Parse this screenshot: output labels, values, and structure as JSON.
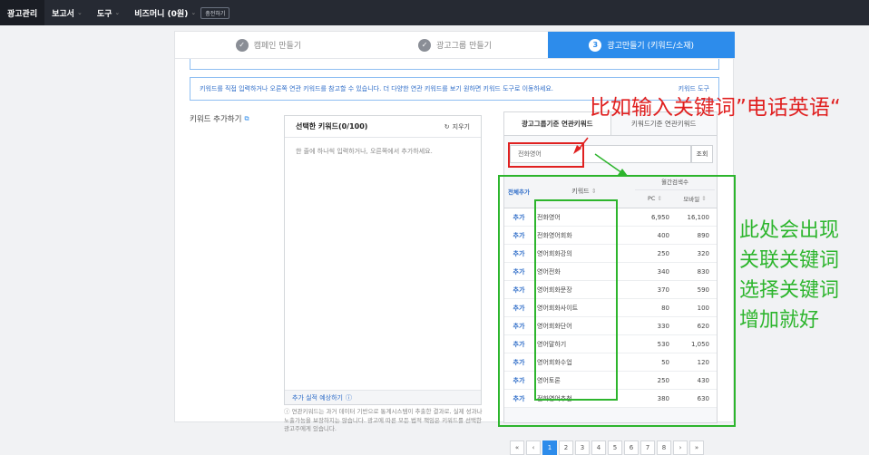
{
  "topnav": {
    "items": [
      {
        "label": "광고관리"
      },
      {
        "label": "보고서"
      },
      {
        "label": "도구"
      },
      {
        "label": "비즈머니 (0원)"
      }
    ],
    "charge_label": "충전하기"
  },
  "steps": [
    {
      "num": "✓",
      "label": "캠페인 만들기"
    },
    {
      "num": "✓",
      "label": "광고그룹 만들기"
    },
    {
      "num": "3",
      "label": "광고만들기 (키워드/소재)"
    }
  ],
  "notice": {
    "text": "키워드를 직접 입력하거나 오른쪽 연관 키워드를 참고할 수 있습니다. 더 다양한 연관 키워드를 보기 원하면 키워드 도구로 이동하세요.",
    "tool_link": "키워드 도구"
  },
  "keyword_section": {
    "label": "키워드 추가하기",
    "selected_title": "선택한 키워드(0/100)",
    "clear_label": "지우기",
    "hint": "한 줄에 하나씩 입력하거나, 오른쪽에서 추가하세요.",
    "estimate_label": "추가 실적 예상하기",
    "disclaimer": "연관키워드는 과거 데이터 기반으로 통계시스템이 추출한 결과로, 실제 성과나 노출가능을 보장하지는 않습니다. 광고에 따른 모든 법적 책임은 키워드를 선택한 광고주에게 있습니다."
  },
  "related": {
    "tab_group": "광고그룹기준 연관키워드",
    "tab_keyword": "키워드기준 연관키워드",
    "search_value": "전화영어",
    "search_button": "조회",
    "col_addall": "전체추가",
    "col_keyword": "키워드",
    "col_monthly": "월간검색수",
    "col_pc": "PC",
    "col_mobile": "모바일",
    "add_label": "추가",
    "rows": [
      {
        "keyword": "전화영어",
        "pc": "6,950",
        "mobile": "16,100"
      },
      {
        "keyword": "전화영어회화",
        "pc": "400",
        "mobile": "890"
      },
      {
        "keyword": "영어회화강의",
        "pc": "250",
        "mobile": "320"
      },
      {
        "keyword": "영어전화",
        "pc": "340",
        "mobile": "830"
      },
      {
        "keyword": "영어회화문장",
        "pc": "370",
        "mobile": "590"
      },
      {
        "keyword": "영어회화사이트",
        "pc": "80",
        "mobile": "100"
      },
      {
        "keyword": "영어회화단어",
        "pc": "330",
        "mobile": "620"
      },
      {
        "keyword": "영어말하기",
        "pc": "530",
        "mobile": "1,050"
      },
      {
        "keyword": "영어회화수업",
        "pc": "50",
        "mobile": "120"
      },
      {
        "keyword": "영어토론",
        "pc": "250",
        "mobile": "430"
      },
      {
        "keyword": "전화영어추천",
        "pc": "380",
        "mobile": "630"
      }
    ],
    "pages": [
      "«",
      "‹",
      "1",
      "2",
      "3",
      "4",
      "5",
      "6",
      "7",
      "8",
      "›",
      "»"
    ],
    "current_page": "1"
  },
  "annotations": {
    "red_text": "比如输入关键词”电话英语“",
    "green_lines": [
      "此处会出现",
      "关联关键词",
      "选择关键词",
      "增加就好"
    ]
  },
  "colors": {
    "accent": "#2d8ceb",
    "red_annotation": "#e02020",
    "green_annotation": "#2db52d",
    "nav_bg": "#262a33"
  }
}
